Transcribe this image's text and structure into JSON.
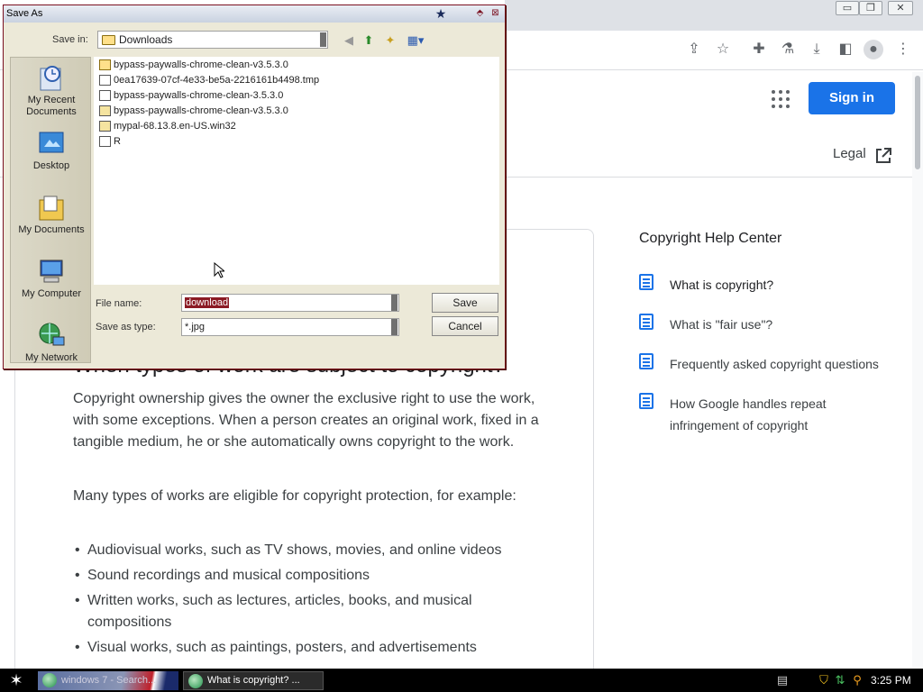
{
  "browser": {
    "header": {
      "sign_in_label": "Sign in",
      "legal_label": "Legal"
    },
    "toolbar_icons": [
      "share-icon",
      "star-icon",
      "extensions-icon",
      "flask-icon",
      "download-icon",
      "sidepanel-icon",
      "profile-icon",
      "menu-icon"
    ],
    "window_controls": [
      "minimize",
      "restore",
      "close"
    ]
  },
  "article": {
    "heading": "When types of work are subject to copyright?",
    "paragraph1": "Copyright ownership gives the owner the exclusive right to use the work, with some exceptions. When a person creates an original work, fixed in a tangible medium, he or she automatically owns copyright to the work.",
    "paragraph2": "Many types of works are eligible for copyright protection, for example:",
    "bullets": [
      "Audiovisual works, such as TV shows, movies, and online videos",
      "Sound recordings and musical compositions",
      "Written works, such as lectures, articles, books, and musical compositions",
      "Visual works, such as paintings, posters, and advertisements"
    ]
  },
  "sidebar": {
    "title": "Copyright Help Center",
    "items": [
      {
        "label": "What is copyright?"
      },
      {
        "label": "What is \"fair use\"?"
      },
      {
        "label": "Frequently asked copyright questions"
      },
      {
        "label": "How Google handles repeat infringement of copyright"
      }
    ]
  },
  "dialog": {
    "title": "Save As",
    "save_in_label": "Save in:",
    "save_in_value": "Downloads",
    "places": [
      {
        "label": "My Recent Documents"
      },
      {
        "label": "Desktop"
      },
      {
        "label": "My Documents"
      },
      {
        "label": "My Computer"
      },
      {
        "label": "My Network"
      }
    ],
    "files": [
      {
        "name": "bypass-paywalls-chrome-clean-v3.5.3.0",
        "type": "folder"
      },
      {
        "name": "0ea17639-07cf-4e33-be5a-2216161b4498.tmp",
        "type": "doc"
      },
      {
        "name": "bypass-paywalls-chrome-clean-3.5.3.0",
        "type": "doc"
      },
      {
        "name": "bypass-paywalls-chrome-clean-v3.5.3.0",
        "type": "zip"
      },
      {
        "name": "mypal-68.13.8.en-US.win32",
        "type": "zip"
      },
      {
        "name": "R",
        "type": "doc"
      }
    ],
    "file_name_label": "File name:",
    "file_name_value": "download",
    "save_as_type_label": "Save as type:",
    "save_as_type_value": "*.jpg",
    "save_button": "Save",
    "cancel_button": "Cancel"
  },
  "taskbar": {
    "task1_label": "windows 7 - Search...",
    "task2_label": "What is copyright? ...",
    "clock": "3:25 PM"
  },
  "colors": {
    "accent": "#1a73e8",
    "dialog_bg": "#ece9d8",
    "selection": "#8b1a24"
  }
}
